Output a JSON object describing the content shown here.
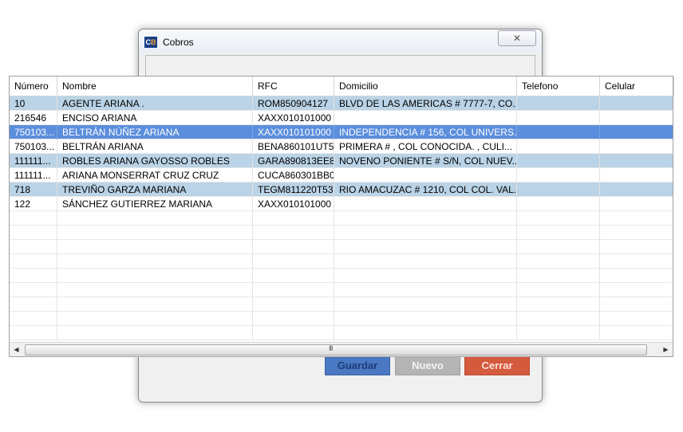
{
  "cobros": {
    "title": "Cobros",
    "close_icon": "close-icon",
    "close_glyph": "✕",
    "icon_text_left": "C",
    "icon_text_right": "B",
    "buttons": {
      "guardar": "Guardar",
      "nuevo": "Nuevo",
      "cerrar": "Cerrar"
    },
    "colors": {
      "guardar": "#4a78c2",
      "nuevo": "#b4b4b4",
      "cerrar": "#d45a3d"
    }
  },
  "grid": {
    "columns": [
      "Número",
      "Nombre",
      "RFC",
      "Domicilio",
      "Telefono",
      "Celular"
    ],
    "rows": [
      {
        "numero": "10",
        "nombre": "AGENTE ARIANA .",
        "rfc": "ROM850904127",
        "domicilio": "BLVD DE LAS AMERICAS # 7777-7, CO...",
        "telefono": "",
        "celular": ""
      },
      {
        "numero": "216546",
        "nombre": "ENCISO  ARIANA",
        "rfc": "XAXX010101000",
        "domicilio": "",
        "telefono": "",
        "celular": ""
      },
      {
        "numero": "750103...",
        "nombre": "BELTRÁN NÚÑEZ ARIANA",
        "rfc": "XAXX010101000",
        "domicilio": "INDEPENDENCIA # 156, COL UNIVERS...",
        "telefono": "",
        "celular": ""
      },
      {
        "numero": "750103...",
        "nombre": "BELTRÁN  ARIANA",
        "rfc": "BENA860101UT5",
        "domicilio": "PRIMERA # , COL CONOCIDA.    , CULI...",
        "telefono": "",
        "celular": ""
      },
      {
        "numero": "111111...",
        "nombre": "ROBLES  ARIANA GAYOSSO ROBLES",
        "rfc": "GARA890813EE8",
        "domicilio": "NOVENO PONIENTE # S/N, COL NUEV...",
        "telefono": "",
        "celular": ""
      },
      {
        "numero": "111111...",
        "nombre": "ARIANA MONSERRAT CRUZ CRUZ",
        "rfc": "CUCA860301BB0",
        "domicilio": "",
        "telefono": "",
        "celular": ""
      },
      {
        "numero": "718",
        "nombre": "TREVIÑO GARZA MARIANA",
        "rfc": "TEGM811220T53",
        "domicilio": "RIO AMACUZAC # 1210, COL COL. VAL...",
        "telefono": "",
        "celular": ""
      },
      {
        "numero": "122",
        "nombre": "SÁNCHEZ GUTIERREZ MARIANA",
        "rfc": "XAXX010101000",
        "domicilio": "",
        "telefono": "",
        "celular": ""
      }
    ],
    "selected_row_index": 2,
    "scrollbar": {
      "left_icon": "scroll-left-icon",
      "right_icon": "scroll-right-icon",
      "left_glyph": "◀",
      "right_glyph": "▶",
      "grip_glyph": "III"
    },
    "colors": {
      "alt_row": "#bad3e6",
      "selected_row": "#5b8edc"
    }
  }
}
